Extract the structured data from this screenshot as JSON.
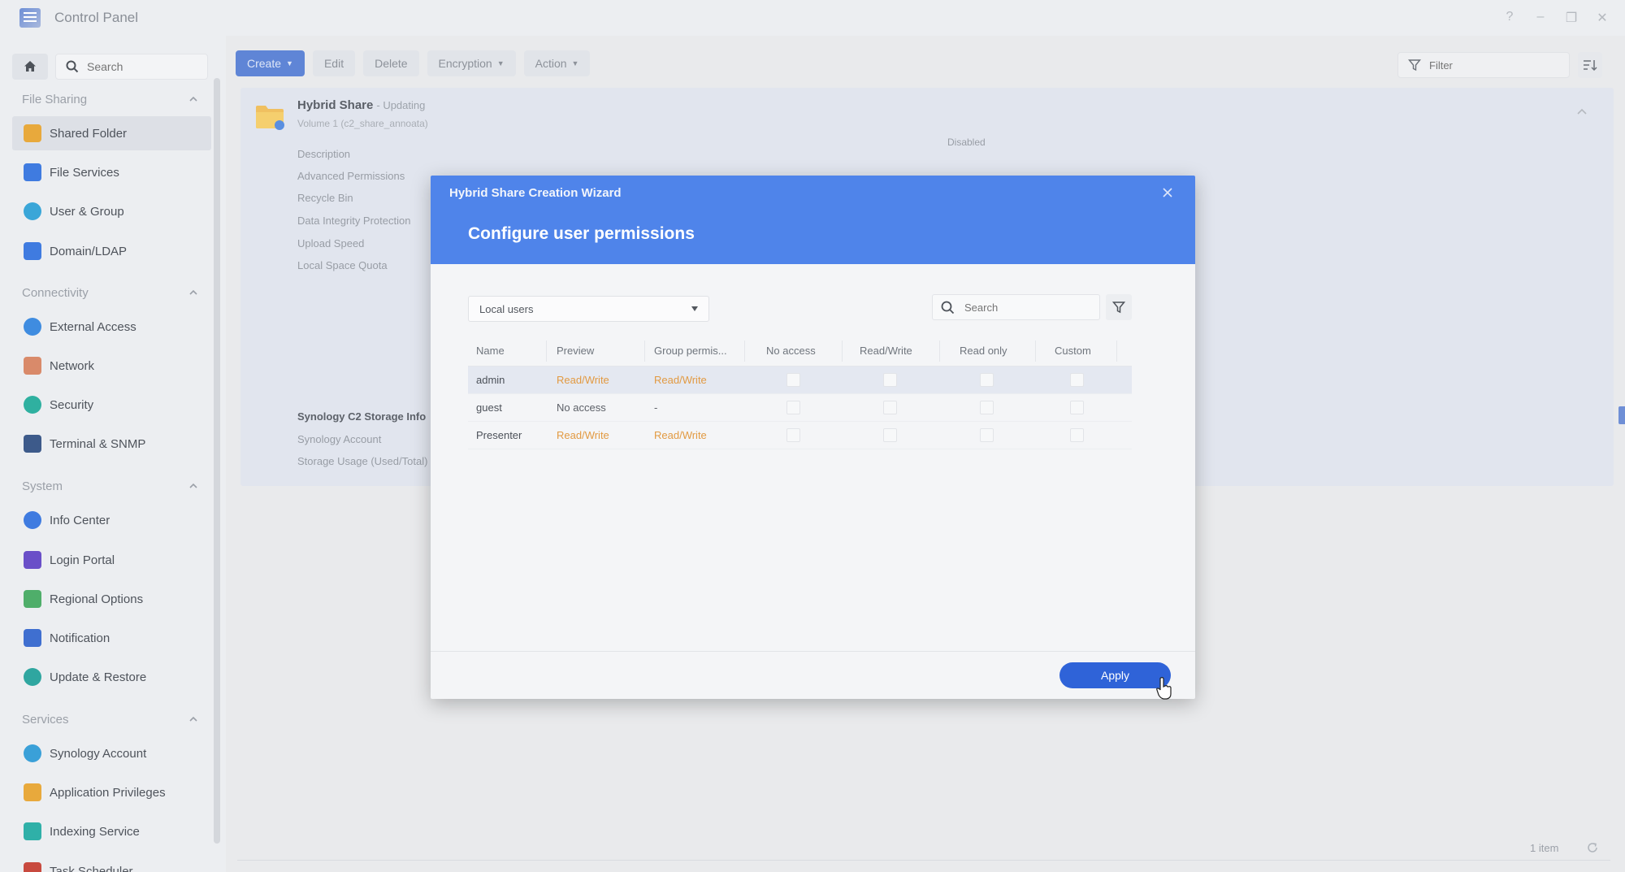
{
  "window": {
    "title": "Control Panel",
    "controls": [
      "?",
      "–",
      "❐",
      "✕"
    ]
  },
  "sidebar": {
    "search_placeholder": "Search",
    "sections": [
      {
        "label": "File Sharing",
        "items": [
          "Shared Folder",
          "File Services",
          "User & Group",
          "Domain/LDAP"
        ]
      },
      {
        "label": "Connectivity",
        "items": [
          "External Access",
          "Network",
          "Security",
          "Terminal & SNMP"
        ]
      },
      {
        "label": "System",
        "items": [
          "Info Center",
          "Login Portal",
          "Regional Options",
          "Notification",
          "Update & Restore"
        ]
      },
      {
        "label": "Services",
        "items": [
          "Synology Account",
          "Application Privileges",
          "Indexing Service",
          "Task Scheduler"
        ]
      }
    ],
    "active_item": "Shared Folder"
  },
  "toolbar": {
    "create": "Create",
    "edit": "Edit",
    "delete": "Delete",
    "encryption": "Encryption",
    "action": "Action",
    "filter_placeholder": "Filter"
  },
  "share": {
    "name": "Hybrid Share",
    "status": "- Updating",
    "volume": "Volume 1 (c2_share_annoata)",
    "properties": [
      "Description",
      "Advanced Permissions",
      "Recycle Bin",
      "Data Integrity Protection",
      "Upload Speed",
      "Local Space Quota"
    ],
    "advanced_permissions_value": "Disabled",
    "storage_section": "Synology C2 Storage Info",
    "storage_properties": [
      "Synology Account",
      "Storage Usage (Used/Total)"
    ]
  },
  "footer": {
    "items_count": "1 item"
  },
  "wizard": {
    "title": "Hybrid Share Creation Wizard",
    "heading": "Configure user permissions",
    "user_type": "Local users",
    "search_placeholder": "Search",
    "columns": [
      "Name",
      "Preview",
      "Group permis...",
      "No access",
      "Read/Write",
      "Read only",
      "Custom"
    ],
    "rows": [
      {
        "name": "admin",
        "preview": "Read/Write",
        "group": "Read/Write",
        "selected": true
      },
      {
        "name": "guest",
        "preview": "No access",
        "group": "-",
        "selected": false
      },
      {
        "name": "Presenter",
        "preview": "Read/Write",
        "group": "Read/Write",
        "selected": false
      }
    ],
    "apply": "Apply"
  },
  "colors": {
    "accent": "#4f84ea",
    "apply": "#2f63d8",
    "permission": "#e29a42"
  }
}
